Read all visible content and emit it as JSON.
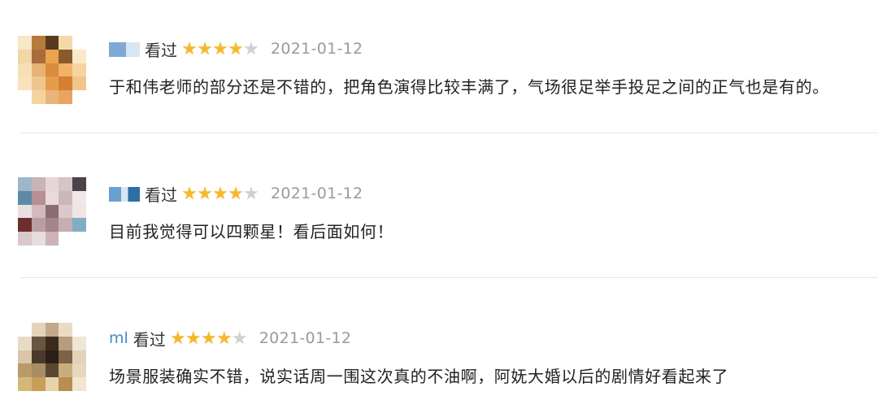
{
  "reviews": [
    {
      "username": "",
      "status": "看过",
      "rating": 4,
      "max_rating": 5,
      "date": "2021-01-12",
      "content": "于和伟老师的部分还是不错的，把角色演得比较丰满了，气场很足举手投足之间的正气也是有的。"
    },
    {
      "username": "",
      "status": "看过",
      "rating": 4,
      "max_rating": 5,
      "date": "2021-01-12",
      "content": "目前我觉得可以四颗星！看后面如何！"
    },
    {
      "username": "ml",
      "status": "看过",
      "rating": 4,
      "max_rating": 5,
      "date": "2021-01-12",
      "content": "场景服装确实不错，说实话周一围这次真的不油啊，阿妩大婚以后的剧情好看起来了"
    }
  ],
  "colors": {
    "star_on": "#f7b72d",
    "star_off": "#d0d0d0",
    "date": "#9a9a9a",
    "divider": "#e6e6e6"
  },
  "icons": [
    "user-avatar",
    "star-icon"
  ]
}
